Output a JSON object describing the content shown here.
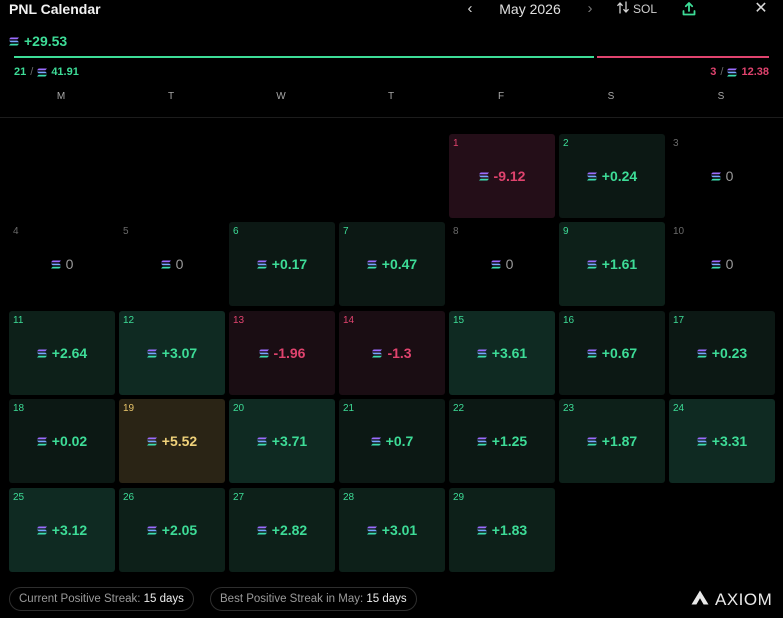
{
  "header": {
    "title": "PNL Calendar",
    "month": "May 2026",
    "prev_icon": "chevron-left-icon",
    "next_icon": "chevron-right-icon",
    "currency": "SOL",
    "swap_icon": "swap-vertical-icon",
    "share_icon": "upload-icon",
    "close_icon": "close-icon"
  },
  "summary": {
    "total": "+29.53",
    "win_days": "21",
    "win_separator": "/",
    "win_total": "41.91",
    "loss_days": "3",
    "loss_separator": "/",
    "loss_total": "12.38",
    "win_ratio": 0.77
  },
  "weekdays": [
    "M",
    "T",
    "W",
    "T",
    "F",
    "S",
    "S"
  ],
  "days": [
    {
      "day": "1",
      "value": "-9.12",
      "kind": "neg",
      "shade": "neg2",
      "col": 4,
      "row": 0
    },
    {
      "day": "2",
      "value": "+0.24",
      "kind": "pos",
      "shade": "pos1",
      "col": 5,
      "row": 0
    },
    {
      "day": "3",
      "value": "0",
      "kind": "zero",
      "shade": "",
      "col": 6,
      "row": 0
    },
    {
      "day": "4",
      "value": "0",
      "kind": "zero",
      "shade": "",
      "col": 0,
      "row": 1
    },
    {
      "day": "5",
      "value": "0",
      "kind": "zero",
      "shade": "",
      "col": 1,
      "row": 1
    },
    {
      "day": "6",
      "value": "+0.17",
      "kind": "pos",
      "shade": "pos1",
      "col": 2,
      "row": 1
    },
    {
      "day": "7",
      "value": "+0.47",
      "kind": "pos",
      "shade": "pos1",
      "col": 3,
      "row": 1
    },
    {
      "day": "8",
      "value": "0",
      "kind": "zero",
      "shade": "",
      "col": 4,
      "row": 1
    },
    {
      "day": "9",
      "value": "+1.61",
      "kind": "pos",
      "shade": "pos2",
      "col": 5,
      "row": 1
    },
    {
      "day": "10",
      "value": "0",
      "kind": "zero",
      "shade": "",
      "col": 6,
      "row": 1
    },
    {
      "day": "11",
      "value": "+2.64",
      "kind": "pos",
      "shade": "pos2",
      "col": 0,
      "row": 2
    },
    {
      "day": "12",
      "value": "+3.07",
      "kind": "pos",
      "shade": "pos3",
      "col": 1,
      "row": 2
    },
    {
      "day": "13",
      "value": "-1.96",
      "kind": "neg",
      "shade": "neg1",
      "col": 2,
      "row": 2
    },
    {
      "day": "14",
      "value": "-1.3",
      "kind": "neg",
      "shade": "neg1",
      "col": 3,
      "row": 2
    },
    {
      "day": "15",
      "value": "+3.61",
      "kind": "pos",
      "shade": "pos3",
      "col": 4,
      "row": 2
    },
    {
      "day": "16",
      "value": "+0.67",
      "kind": "pos",
      "shade": "pos1",
      "col": 5,
      "row": 2
    },
    {
      "day": "17",
      "value": "+0.23",
      "kind": "pos",
      "shade": "pos1",
      "col": 6,
      "row": 2
    },
    {
      "day": "18",
      "value": "+0.02",
      "kind": "pos",
      "shade": "pos1",
      "col": 0,
      "row": 3
    },
    {
      "day": "19",
      "value": "+5.52",
      "kind": "best",
      "shade": "",
      "col": 1,
      "row": 3
    },
    {
      "day": "20",
      "value": "+3.71",
      "kind": "pos",
      "shade": "pos3",
      "col": 2,
      "row": 3
    },
    {
      "day": "21",
      "value": "+0.7",
      "kind": "pos",
      "shade": "pos1",
      "col": 3,
      "row": 3
    },
    {
      "day": "22",
      "value": "+1.25",
      "kind": "pos",
      "shade": "pos1",
      "col": 4,
      "row": 3
    },
    {
      "day": "23",
      "value": "+1.87",
      "kind": "pos",
      "shade": "pos2",
      "col": 5,
      "row": 3
    },
    {
      "day": "24",
      "value": "+3.31",
      "kind": "pos",
      "shade": "pos3",
      "col": 6,
      "row": 3
    },
    {
      "day": "25",
      "value": "+3.12",
      "kind": "pos",
      "shade": "pos3",
      "col": 0,
      "row": 4
    },
    {
      "day": "26",
      "value": "+2.05",
      "kind": "pos",
      "shade": "pos2",
      "col": 1,
      "row": 4
    },
    {
      "day": "27",
      "value": "+2.82",
      "kind": "pos",
      "shade": "pos2",
      "col": 2,
      "row": 4
    },
    {
      "day": "28",
      "value": "+3.01",
      "kind": "pos",
      "shade": "pos2",
      "col": 3,
      "row": 4
    },
    {
      "day": "29",
      "value": "+1.83",
      "kind": "pos",
      "shade": "pos2",
      "col": 4,
      "row": 4
    }
  ],
  "streaks": {
    "current_label": "Current Positive Streak:",
    "current_value": "15 days",
    "best_label": "Best Positive Streak in May:",
    "best_value": "15 days"
  },
  "brand": {
    "name": "AXIOM",
    "logo_icon": "axiom-logo-icon"
  },
  "colors": {
    "positive": "#3ddc97",
    "negative": "#e0436e",
    "best": "#f0d27a",
    "background": "#000000"
  }
}
